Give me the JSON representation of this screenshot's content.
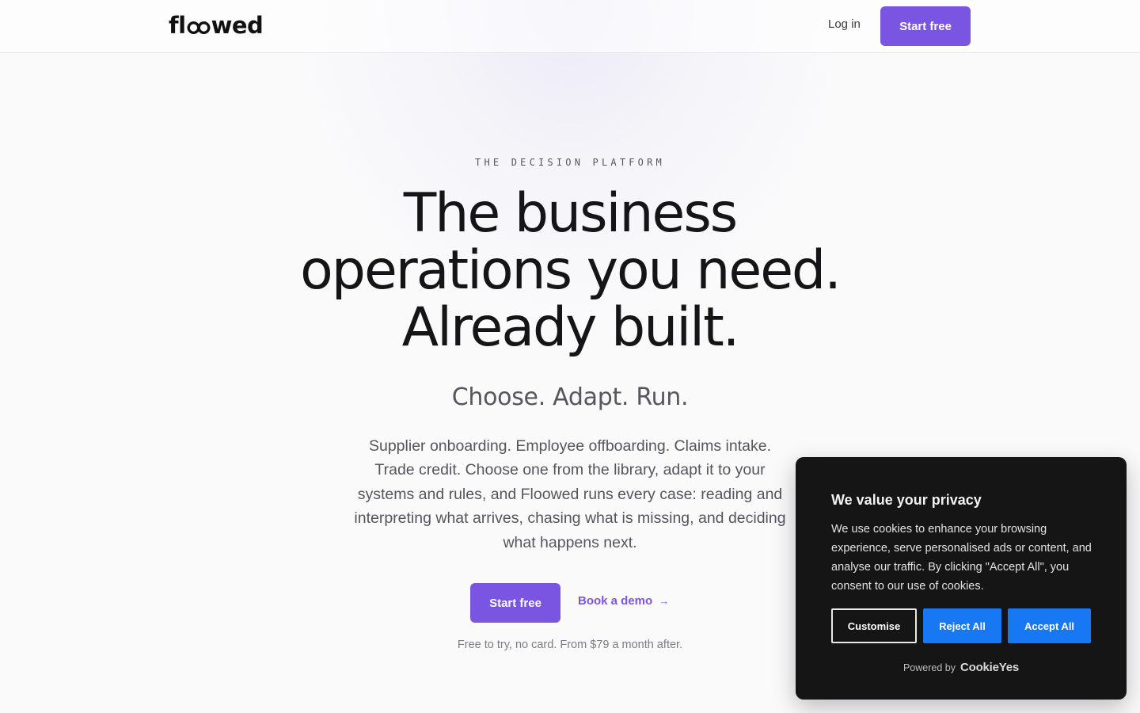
{
  "nav": {
    "logo_prefix": "fl",
    "logo_suffix": "wed",
    "login_label": "Log in",
    "start_label": "Start free"
  },
  "hero": {
    "eyebrow": "THE DECISION PLATFORM",
    "headline": "The business operations you need. Already built.",
    "tagline": "Choose. Adapt. Run.",
    "description": "Supplier onboarding. Employee offboarding. Claims intake. Trade credit. Choose one from the library, adapt it to your systems and rules, and Floowed runs every case: reading and interpreting what arrives, chasing what is missing, and deciding what happens next.",
    "start_label": "Start free",
    "demo_label": "Book a demo",
    "demo_arrow": "→",
    "note": "Free to try, no card. From $79 a month after."
  },
  "cookie": {
    "title": "We value your privacy",
    "body": "We use cookies to enhance your browsing experience, serve personalised ads or content, and analyse our traffic. By clicking \"Accept All\", you consent to our use of cookies.",
    "customise_label": "Customise",
    "reject_label": "Reject All",
    "accept_label": "Accept All",
    "powered_by": "Powered by",
    "brand": "CookieYes"
  },
  "colors": {
    "accent": "#7a55e2",
    "cookie_bg": "#151515",
    "cookie_button": "#1877f2"
  }
}
